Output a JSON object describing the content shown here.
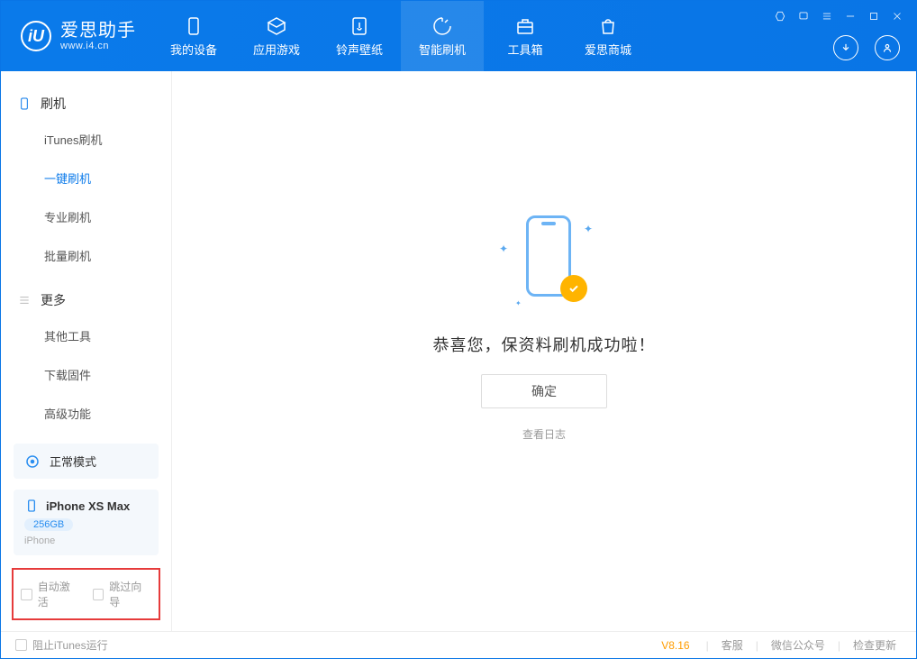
{
  "app": {
    "name_cn": "爱思助手",
    "name_en": "www.i4.cn"
  },
  "nav": {
    "items": [
      {
        "label": "我的设备",
        "icon": "device-icon"
      },
      {
        "label": "应用游戏",
        "icon": "apps-icon"
      },
      {
        "label": "铃声壁纸",
        "icon": "music-icon"
      },
      {
        "label": "智能刷机",
        "icon": "flash-icon",
        "active": true
      },
      {
        "label": "工具箱",
        "icon": "toolbox-icon"
      },
      {
        "label": "爱思商城",
        "icon": "store-icon"
      }
    ]
  },
  "sidebar": {
    "section1": {
      "title": "刷机",
      "items": [
        {
          "label": "iTunes刷机"
        },
        {
          "label": "一键刷机",
          "active": true
        },
        {
          "label": "专业刷机"
        },
        {
          "label": "批量刷机"
        }
      ]
    },
    "section2": {
      "title": "更多",
      "items": [
        {
          "label": "其他工具"
        },
        {
          "label": "下载固件"
        },
        {
          "label": "高级功能"
        }
      ]
    },
    "mode": {
      "label": "正常模式"
    },
    "device": {
      "name": "iPhone XS Max",
      "storage": "256GB",
      "type": "iPhone"
    },
    "options": {
      "auto_activate": "自动激活",
      "skip_guide": "跳过向导"
    }
  },
  "main": {
    "success_text": "恭喜您，保资料刷机成功啦！",
    "ok_button": "确定",
    "log_link": "查看日志"
  },
  "footer": {
    "block_itunes": "阻止iTunes运行",
    "version": "V8.16",
    "links": {
      "support": "客服",
      "wechat": "微信公众号",
      "update": "检查更新"
    }
  }
}
